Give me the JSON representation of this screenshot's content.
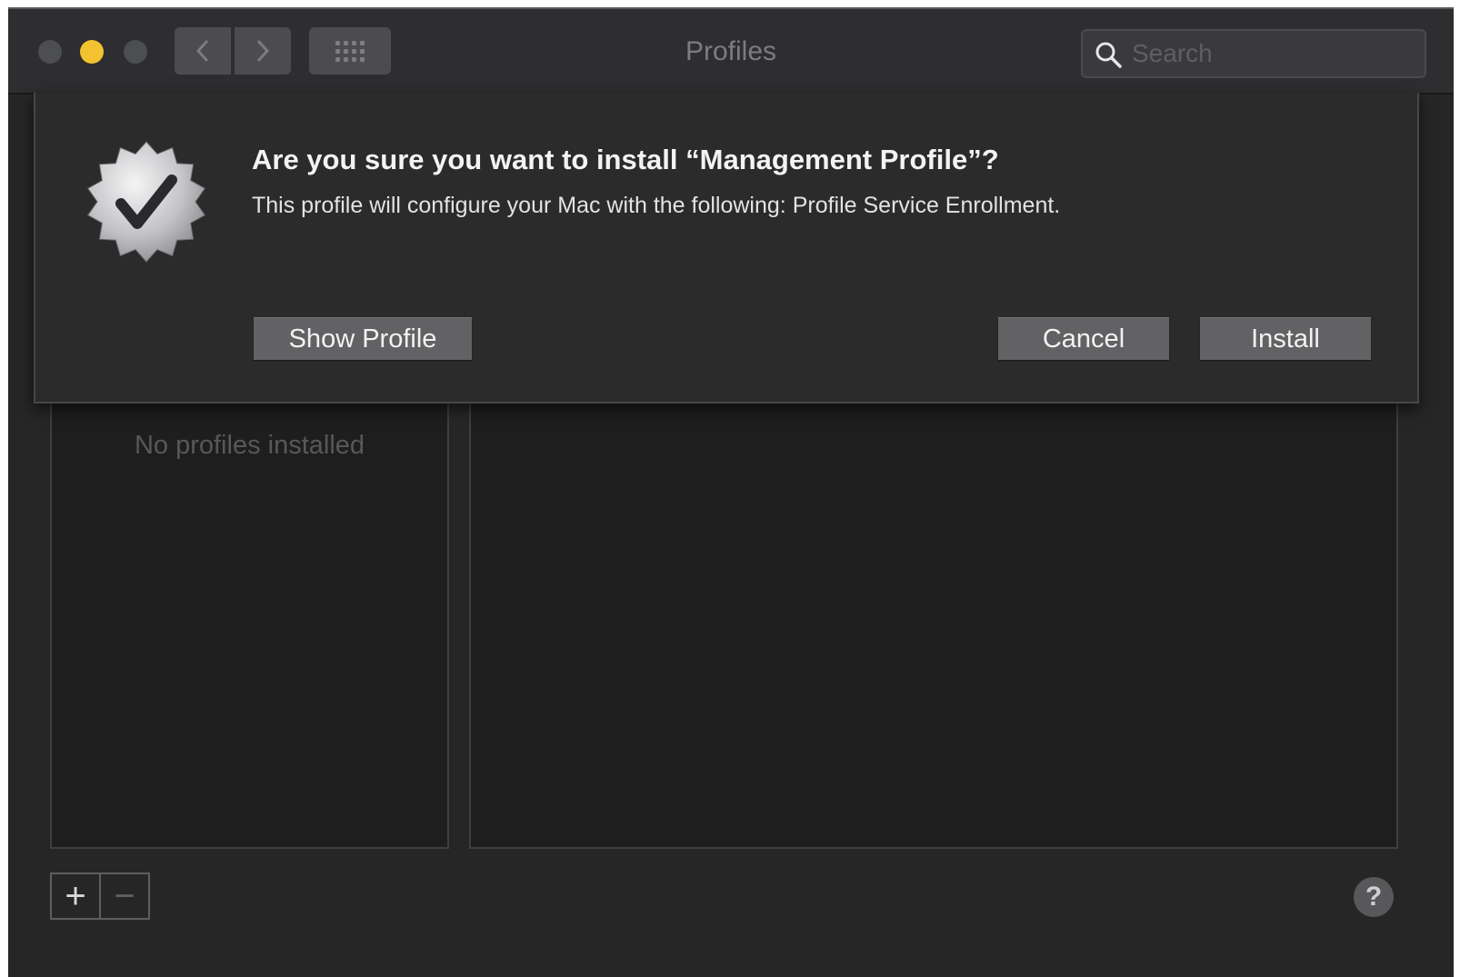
{
  "window": {
    "title": "Profiles"
  },
  "toolbar": {
    "back_icon": "chevron-left-icon",
    "forward_icon": "chevron-right-icon",
    "grid_icon": "show-all-grid-icon",
    "search_placeholder": "Search",
    "search_value": ""
  },
  "dialog": {
    "title": "Are you sure you want to install “Management Profile”?",
    "message": "This profile will configure your Mac with the following: Profile Service Enrollment.",
    "icon": "verified-badge-icon",
    "buttons": {
      "show_profile": "Show Profile",
      "cancel": "Cancel",
      "install": "Install"
    }
  },
  "profiles_list": {
    "empty_text": "No profiles installed"
  },
  "footer": {
    "add_label": "+",
    "remove_label": "−",
    "help_label": "?"
  },
  "colors": {
    "window_background": "#262627",
    "minimize_button": "#f2c230",
    "button_background": "#626264"
  }
}
